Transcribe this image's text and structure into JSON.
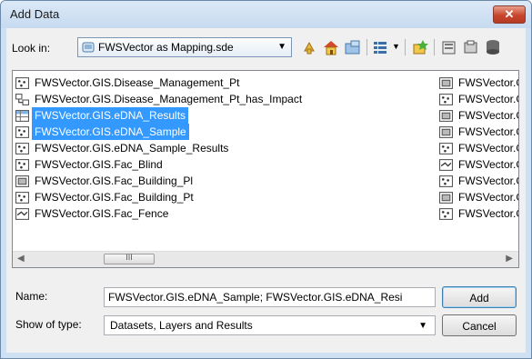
{
  "window": {
    "title": "Add Data",
    "close_glyph": "✕"
  },
  "lookin": {
    "label": "Look in:",
    "value": "FWSVector as Mapping.sde"
  },
  "toolbar": {
    "buttons": [
      "up-one-level-icon",
      "home-icon",
      "connect-folder-icon",
      "view-options-icon",
      "new-item-icon",
      "catalog-icon",
      "toggle-contents-icon",
      "database-icon"
    ]
  },
  "files": {
    "column1": [
      {
        "name": "FWSVector.GIS.Disease_Management_Pt",
        "icon": "point-feature-class-icon",
        "selected": false
      },
      {
        "name": "FWSVector.GIS.Disease_Management_Pt_has_Impact",
        "icon": "relationship-class-icon",
        "selected": false
      },
      {
        "name": "FWSVector.GIS.eDNA_Results",
        "icon": "table-icon",
        "selected": true
      },
      {
        "name": "FWSVector.GIS.eDNA_Sample",
        "icon": "point-feature-class-icon",
        "selected": true
      },
      {
        "name": "FWSVector.GIS.eDNA_Sample_Results",
        "icon": "point-feature-class-icon",
        "selected": false
      },
      {
        "name": "FWSVector.GIS.Fac_Blind",
        "icon": "point-feature-class-icon",
        "selected": false
      },
      {
        "name": "FWSVector.GIS.Fac_Building_Pl",
        "icon": "polygon-feature-class-icon",
        "selected": false
      },
      {
        "name": "FWSVector.GIS.Fac_Building_Pt",
        "icon": "point-feature-class-icon",
        "selected": false
      },
      {
        "name": "FWSVector.GIS.Fac_Fence",
        "icon": "line-feature-class-icon",
        "selected": false
      }
    ],
    "column2": [
      {
        "name": "FWSVector.GI",
        "icon": "polygon-feature-class-icon"
      },
      {
        "name": "FWSVector.GI",
        "icon": "point-feature-class-icon"
      },
      {
        "name": "FWSVector.GI",
        "icon": "polygon-feature-class-icon"
      },
      {
        "name": "FWSVector.GI",
        "icon": "polygon-feature-class-icon"
      },
      {
        "name": "FWSVector.GI",
        "icon": "point-feature-class-icon"
      },
      {
        "name": "FWSVector.GI",
        "icon": "line-feature-class-icon"
      },
      {
        "name": "FWSVector.GI",
        "icon": "point-feature-class-icon"
      },
      {
        "name": "FWSVector.GI",
        "icon": "polygon-feature-class-icon"
      },
      {
        "name": "FWSVector.GI",
        "icon": "point-feature-class-icon"
      }
    ]
  },
  "scrollbar": {
    "thumb_glyph": "III"
  },
  "form": {
    "name_label": "Name:",
    "name_value": "FWSVector.GIS.eDNA_Sample; FWSVector.GIS.eDNA_Resi",
    "type_label": "Show of type:",
    "type_value": "Datasets, Layers and Results"
  },
  "buttons": {
    "add": "Add",
    "cancel": "Cancel"
  }
}
